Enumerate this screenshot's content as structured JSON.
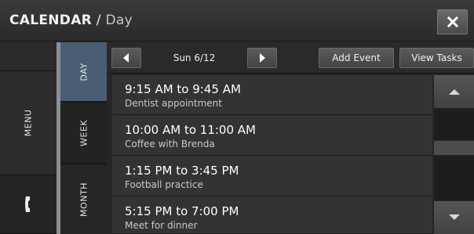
{
  "header": {
    "app_title": "CALENDAR",
    "separator": " / ",
    "view_title": "Day",
    "close_icon": "close-icon"
  },
  "rail": {
    "menu_label": "MENU",
    "phone_icon": "phone-icon"
  },
  "tabs": [
    {
      "label": "DAY",
      "selected": true
    },
    {
      "label": "WEEK",
      "selected": false
    },
    {
      "label": "MONTH",
      "selected": false
    }
  ],
  "toolbar": {
    "prev_icon": "triangle-left-icon",
    "date": "Sun 6/12",
    "next_icon": "triangle-right-icon",
    "add_event_label": "Add Event",
    "view_tasks_label": "View Tasks"
  },
  "events": [
    {
      "time": "9:15 AM to 9:45 AM",
      "title": "Dentist appointment"
    },
    {
      "time": "10:00 AM to 11:00 AM",
      "title": "Coffee with Brenda"
    },
    {
      "time": "1:15 PM to 3:45 PM",
      "title": "Football practice"
    },
    {
      "time": "5:15 PM to 7:00 PM",
      "title": "Meet for dinner"
    }
  ],
  "scrollbar": {
    "up_icon": "triangle-up-icon",
    "down_icon": "triangle-down-icon"
  },
  "colors": {
    "selected_tab": "#4a5d73",
    "background": "#262626"
  }
}
